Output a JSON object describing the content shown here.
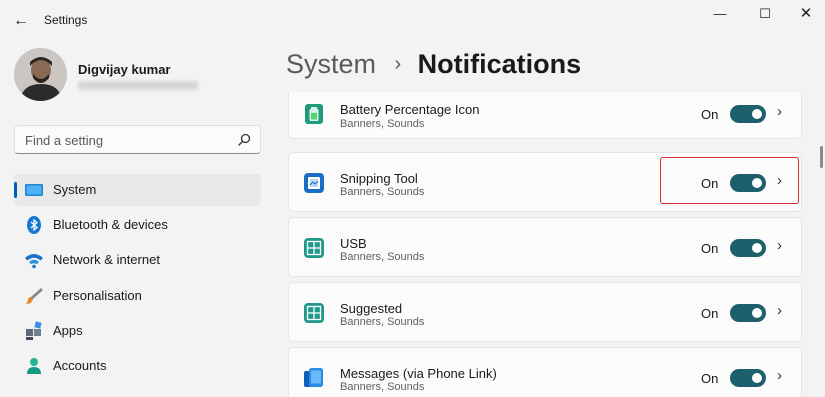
{
  "window": {
    "title": "Settings",
    "back_glyph": "←",
    "minimize_glyph": "—",
    "maximize_glyph": "☐",
    "close_glyph": "✕"
  },
  "profile": {
    "name": "Digvijay kumar"
  },
  "search": {
    "placeholder": "Find a setting"
  },
  "nav": [
    {
      "label": "System",
      "icon": "system-display-icon",
      "selected": true
    },
    {
      "label": "Bluetooth & devices",
      "icon": "bluetooth-icon"
    },
    {
      "label": "Network & internet",
      "icon": "wifi-icon"
    },
    {
      "label": "Personalisation",
      "icon": "brush-icon"
    },
    {
      "label": "Apps",
      "icon": "apps-icon"
    },
    {
      "label": "Accounts",
      "icon": "person-icon"
    }
  ],
  "breadcrumb": {
    "parent": "System",
    "separator": "›",
    "current": "Notifications"
  },
  "notifications": [
    {
      "title": "Battery Percentage Icon",
      "subtitle": "Banners, Sounds",
      "state": "On",
      "icon": "battery-app-icon"
    },
    {
      "title": "Snipping Tool",
      "subtitle": "Banners, Sounds",
      "state": "On",
      "icon": "snipping-tool-icon",
      "highlighted": true
    },
    {
      "title": "USB",
      "subtitle": "Banners, Sounds",
      "state": "On",
      "icon": "usb-app-icon"
    },
    {
      "title": "Suggested",
      "subtitle": "Banners, Sounds",
      "state": "On",
      "icon": "suggested-app-icon"
    },
    {
      "title": "Messages (via Phone Link)",
      "subtitle": "Banners, Sounds",
      "state": "On",
      "icon": "phone-link-icon"
    }
  ],
  "colors": {
    "accent": "#005fb8",
    "toggle_on": "#1d5f6b",
    "highlight_box": "#d32f2f"
  }
}
